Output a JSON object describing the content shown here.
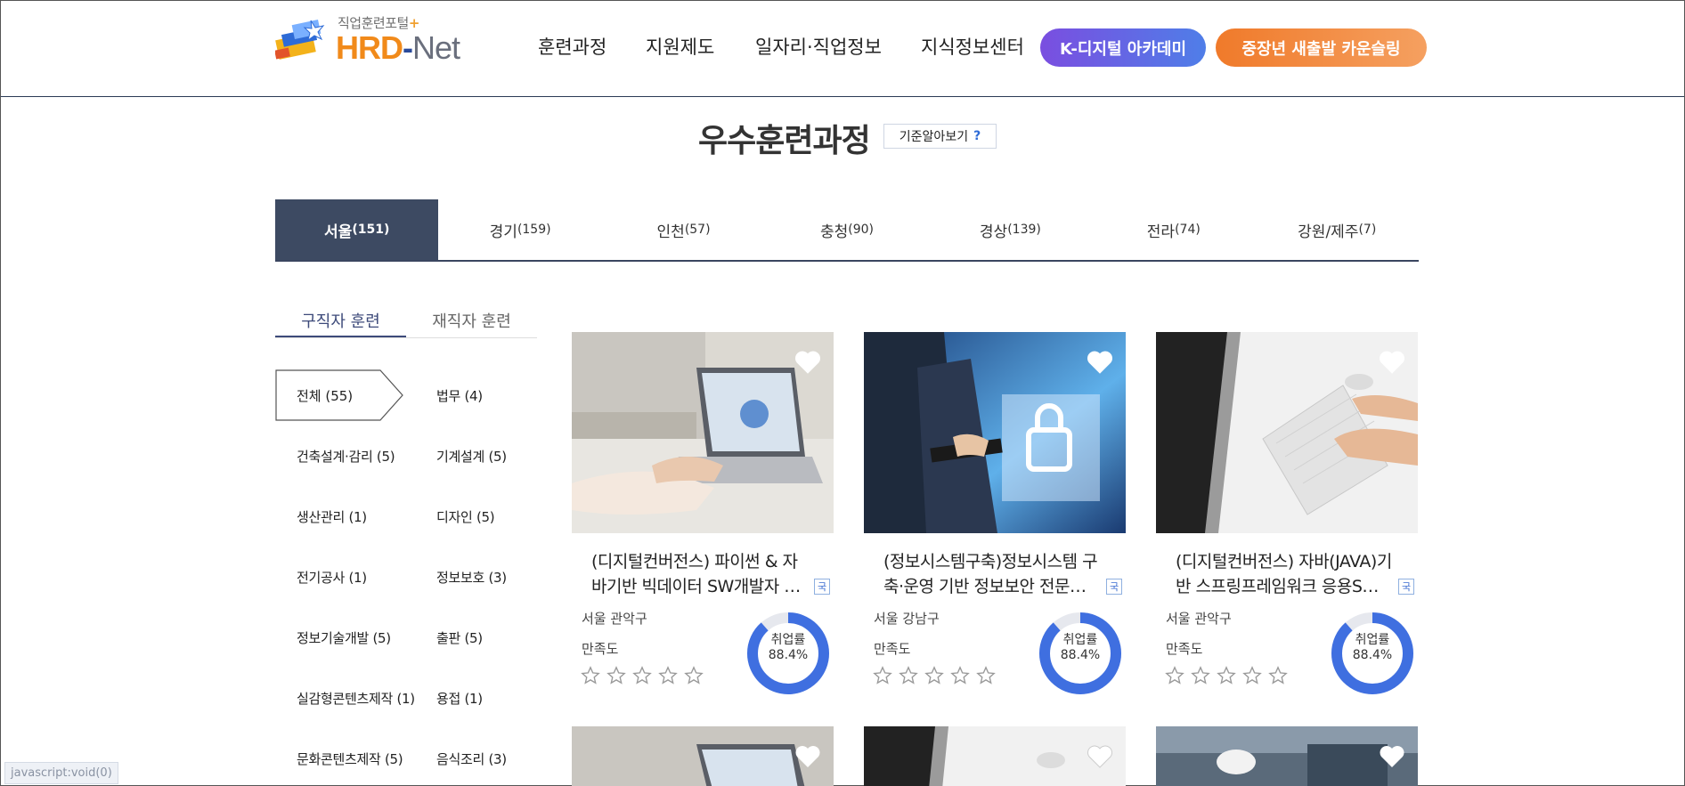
{
  "header": {
    "logo_sub": "직업훈련포털",
    "logo_plus": "+",
    "logo_hrd": "HRD",
    "logo_dash": "-",
    "logo_net": "Net",
    "nav": [
      "훈련과정",
      "지원제도",
      "일자리·직업정보",
      "지식정보센터"
    ],
    "k_digital": "K-디지털 아카데미",
    "midage": "중장년 새출발 카운슬링"
  },
  "title": {
    "text": "우수훈련과정",
    "criteria": "기준알아보기",
    "criteria_q": "?"
  },
  "regions": [
    {
      "name": "서울",
      "count": "(151)"
    },
    {
      "name": "경기",
      "count": "(159)"
    },
    {
      "name": "인천",
      "count": "(57)"
    },
    {
      "name": "충청",
      "count": "(90)"
    },
    {
      "name": "경상",
      "count": "(139)"
    },
    {
      "name": "전라",
      "count": "(74)"
    },
    {
      "name": "강원/제주",
      "count": "(7)"
    }
  ],
  "subtabs": [
    "구직자 훈련",
    "재직자 훈련"
  ],
  "categories": [
    "전체 (55)",
    "법무 (4)",
    "건축설계·감리 (5)",
    "기계설계 (5)",
    "생산관리 (1)",
    "디자인 (5)",
    "전기공사 (1)",
    "정보보호 (3)",
    "정보기술개발 (5)",
    "출판 (5)",
    "실감형콘텐츠제작 (1)",
    "용접 (1)",
    "문화콘텐츠제작 (5)",
    "음식조리 (3)"
  ],
  "cards": [
    {
      "title": "(디지털컨버전스) 파이썬 & 자바기반 빅데이터 SW개발자 …",
      "badge": "국",
      "location": "서울 관악구",
      "satisfaction_label": "만족도",
      "rating": 0,
      "employment_label": "취업률",
      "employment_rate": "88.4%",
      "employment_value": 88.4
    },
    {
      "title": "(정보시스템구축)정보시스템 구축·운영 기반 정보보안 전문…",
      "badge": "국",
      "location": "서울 강남구",
      "satisfaction_label": "만족도",
      "rating": 0,
      "employment_label": "취업률",
      "employment_rate": "88.4%",
      "employment_value": 88.4
    },
    {
      "title": "(디지털컨버전스) 자바(JAVA)기반 스프링프레임워크 응용S…",
      "badge": "국",
      "location": "서울 관악구",
      "satisfaction_label": "만족도",
      "rating": 0,
      "employment_label": "취업률",
      "employment_rate": "88.4%",
      "employment_value": 88.4
    }
  ],
  "status_bar": "javascript:void(0)",
  "colors": {
    "accent_dark": "#3d4a62",
    "donut": "#3f6fe0",
    "donut_track": "#e6e8ee",
    "k_digital_start": "#7a4ee0",
    "k_digital_end": "#4f7ee8",
    "midage_start": "#f07a2a",
    "midage_end": "#f5a060"
  }
}
